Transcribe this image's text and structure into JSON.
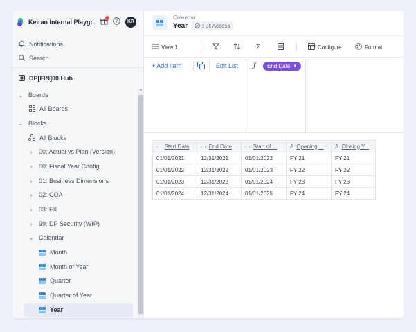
{
  "workspace": {
    "name": "Keiran Internal Playgr...",
    "avatar_initials": "KR",
    "icons": [
      "gift-icon",
      "help-icon"
    ]
  },
  "sidebar": {
    "notifications": "Notifications",
    "search": "Search",
    "hub": "DP[FIN]00 Hub",
    "boards": {
      "label": "Boards",
      "items": [
        "All Boards"
      ]
    },
    "blocks": {
      "label": "Blocks",
      "all_blocks": "All Blocks",
      "folders": [
        "00: Actual vs Plan (Version)",
        "00: Fiscal Year Config",
        "01: Business Dimensions",
        "02: COA",
        "03: FX",
        "99: DP Security (WIP)"
      ],
      "calendar": {
        "label": "Calendar",
        "items": [
          "Month",
          "Month of Year",
          "Quarter",
          "Quarter of Year",
          "Year"
        ],
        "selected": "Year"
      }
    }
  },
  "header": {
    "breadcrumb": "Calendar",
    "title": "Year",
    "access": "Full Access"
  },
  "toolbar": {
    "view": "View 1",
    "configure": "Configure",
    "format": "Format"
  },
  "block": {
    "add_item": "+ Add Item",
    "edit_list": "Edit List",
    "formula_symbol": "ƒ",
    "chip": "End Date"
  },
  "grid": {
    "columns": [
      "Start Date",
      "End Date",
      "Start of ...",
      "Opening ...",
      "Closing Y..."
    ],
    "rows": [
      [
        "01/01/2021",
        "12/31/2021",
        "01/01/2022",
        "FY 21",
        "FY 21"
      ],
      [
        "01/01/2022",
        "12/31/2022",
        "01/01/2023",
        "FY 22",
        "FY 22"
      ],
      [
        "01/01/2023",
        "12/31/2023",
        "01/01/2024",
        "FY 23",
        "FY 23"
      ],
      [
        "01/01/2024",
        "12/31/2024",
        "01/01/2025",
        "FY 24",
        "FY 24"
      ]
    ]
  },
  "colors": {
    "accent": "#2c6fd6",
    "chip": "#7a4fd6",
    "block_icon": "#2e8bdc"
  }
}
